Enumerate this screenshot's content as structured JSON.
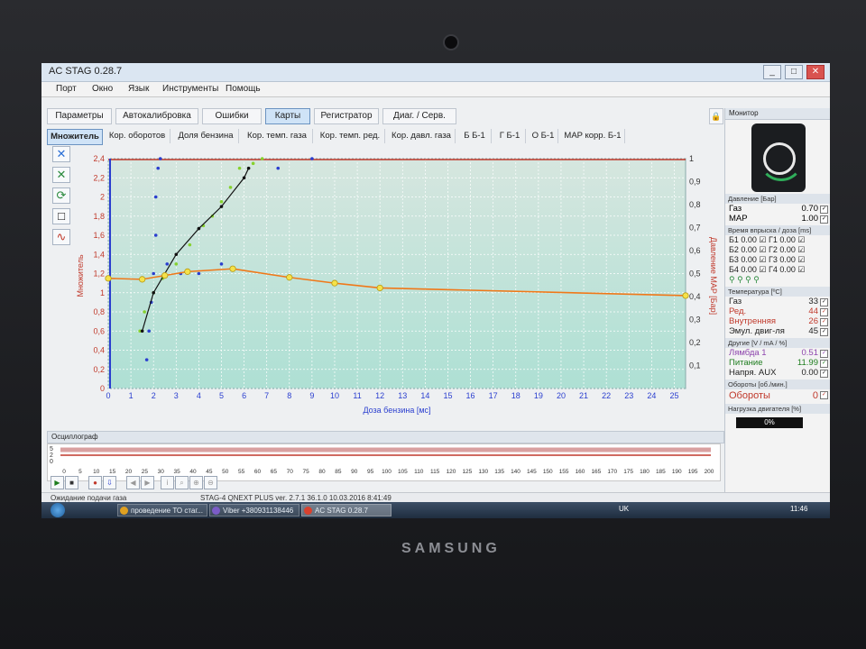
{
  "window": {
    "title": "AC STAG 0.28.7",
    "controls": [
      "_",
      "□",
      "✕"
    ]
  },
  "menu": [
    "Порт",
    "Окно",
    "Язык",
    "Инструменты",
    "Помощь"
  ],
  "tabs_main": [
    {
      "label": "Параметры",
      "active": false
    },
    {
      "label": "Автокалибровка",
      "active": false
    },
    {
      "label": "Ошибки",
      "active": false
    },
    {
      "label": "Карты",
      "active": true
    },
    {
      "label": "Регистратор",
      "active": false
    },
    {
      "label": "Диаг. / Серв.",
      "active": false
    }
  ],
  "tabs_maps": [
    {
      "label": "Множитель",
      "active": true
    },
    {
      "label": "Кор. оборотов",
      "active": false
    },
    {
      "label": "Доля бензина",
      "active": false
    },
    {
      "label": "Кор. темп. газа",
      "active": false
    },
    {
      "label": "Кор. темп. ред.",
      "active": false
    },
    {
      "label": "Кор. давл. газа",
      "active": false
    },
    {
      "label": "Б Б-1",
      "active": false
    },
    {
      "label": "Г Б-1",
      "active": false
    },
    {
      "label": "О Б-1",
      "active": false
    },
    {
      "label": "MAP корр. Б-1",
      "active": false
    }
  ],
  "chart_data": {
    "type": "line",
    "xlabel": "Доза бензина [мс]",
    "ylabel": "Множитель",
    "y2label": "Давление MAP [Бар]",
    "xlim": [
      0,
      25.5
    ],
    "ylim": [
      0,
      2.4
    ],
    "y2lim": [
      0,
      1
    ],
    "x_ticks": [
      "0",
      "1",
      "2",
      "3",
      "4",
      "5",
      "6",
      "7",
      "8",
      "9",
      "10",
      "11",
      "12",
      "13",
      "14",
      "15",
      "16",
      "17",
      "18",
      "19",
      "20",
      "21",
      "22",
      "23",
      "24",
      "25"
    ],
    "y_ticks": [
      "0",
      "0,2",
      "0,4",
      "0,6",
      "0,8",
      "1",
      "1,2",
      "1,4",
      "1,6",
      "1,8",
      "2",
      "2,2",
      "2,4"
    ],
    "y2_ticks": [
      "0,1",
      "0,2",
      "0,3",
      "0,4",
      "0,5",
      "0,6",
      "0,7",
      "0,8",
      "0,9",
      "1"
    ],
    "grid": true,
    "series": [
      {
        "name": "multiplier",
        "color": "#f07818",
        "points": [
          [
            0,
            1.15
          ],
          [
            1.5,
            1.14
          ],
          [
            2.5,
            1.18
          ],
          [
            3.5,
            1.22
          ],
          [
            5.5,
            1.25
          ],
          [
            8,
            1.16
          ],
          [
            10,
            1.1
          ],
          [
            12,
            1.05
          ],
          [
            25.5,
            0.97
          ]
        ]
      },
      {
        "name": "trend",
        "color": "#111111",
        "points": [
          [
            1.5,
            0.6
          ],
          [
            2,
            1.0
          ],
          [
            3,
            1.4
          ],
          [
            4,
            1.67
          ],
          [
            5,
            1.9
          ],
          [
            6,
            2.2
          ],
          [
            6.2,
            2.3
          ]
        ]
      },
      {
        "name": "petrol",
        "color": "#2a3ecf",
        "points": [
          [
            1.7,
            0.3
          ],
          [
            1.8,
            0.6
          ],
          [
            1.9,
            0.9
          ],
          [
            2.0,
            1.2
          ],
          [
            2.1,
            1.6
          ],
          [
            2.1,
            2.0
          ],
          [
            2.2,
            2.3
          ],
          [
            2.3,
            2.4
          ],
          [
            2.6,
            1.3
          ],
          [
            3.2,
            1.2
          ],
          [
            4.0,
            1.2
          ],
          [
            5.0,
            1.3
          ],
          [
            7.5,
            2.3
          ],
          [
            9.0,
            2.4
          ]
        ]
      },
      {
        "name": "gas",
        "color": "#86d12e",
        "points": [
          [
            1.4,
            0.6
          ],
          [
            1.6,
            0.8
          ],
          [
            2.0,
            1.0
          ],
          [
            2.4,
            1.15
          ],
          [
            3.0,
            1.3
          ],
          [
            3.6,
            1.5
          ],
          [
            4.2,
            1.7
          ],
          [
            4.6,
            1.8
          ],
          [
            5.0,
            1.95
          ],
          [
            5.4,
            2.1
          ],
          [
            5.8,
            2.3
          ],
          [
            6.4,
            2.35
          ],
          [
            6.8,
            2.4
          ]
        ]
      }
    ],
    "map_pressure_marker": 0.42
  },
  "monitor": {
    "title": "Монитор",
    "pressure": {
      "title": "Давление [Бар]",
      "rows": [
        {
          "label": "Газ",
          "value": "0.70"
        },
        {
          "label": "MAP",
          "value": "1.00"
        }
      ]
    },
    "injection": {
      "title": "Время впрыска / доза [ms]",
      "rows": [
        {
          "b": "Б1",
          "bv": "0.00",
          "g": "Г1",
          "gv": "0.00"
        },
        {
          "b": "Б2",
          "bv": "0.00",
          "g": "Г2",
          "gv": "0.00"
        },
        {
          "b": "Б3",
          "bv": "0.00",
          "g": "Г3",
          "gv": "0.00"
        },
        {
          "b": "Б4",
          "bv": "0.00",
          "g": "Г4",
          "gv": "0.00"
        }
      ]
    },
    "temperature": {
      "title": "Температура [ºC]",
      "rows": [
        {
          "label": "Газ",
          "value": "33",
          "color": "#222222"
        },
        {
          "label": "Ред.",
          "value": "44",
          "color": "#c0392b"
        },
        {
          "label": "Внутренняя",
          "value": "26",
          "color": "#c0392b"
        },
        {
          "label": "Эмул. двиг-ля",
          "value": "45",
          "color": "#222222"
        }
      ]
    },
    "other": {
      "title": "Другие [V / mA / %]",
      "rows": [
        {
          "label": "Лямбда 1",
          "value": "0.51",
          "color": "#8e44ad"
        },
        {
          "label": "Питание",
          "value": "11.99",
          "color": "#1e7d1e"
        },
        {
          "label": "Напря. AUX",
          "value": "0.00",
          "color": "#222222"
        }
      ]
    },
    "rpm": {
      "title": "Обороты [об./мин.]",
      "label": "Обороты",
      "value": "0"
    },
    "load": {
      "title": "Нагрузка двигателя [%]",
      "value": "0%"
    }
  },
  "oscillograph": {
    "title": "Осциллограф",
    "y_ticks": [
      "5",
      "2",
      "0"
    ],
    "x_ticks": [
      "0",
      "5",
      "10",
      "15",
      "20",
      "25",
      "30",
      "35",
      "40",
      "45",
      "50",
      "55",
      "60",
      "65",
      "70",
      "75",
      "80",
      "85",
      "90",
      "95",
      "100",
      "105",
      "110",
      "115",
      "120",
      "125",
      "130",
      "135",
      "140",
      "145",
      "150",
      "155",
      "160",
      "165",
      "170",
      "175",
      "180",
      "185",
      "190",
      "195",
      "200"
    ]
  },
  "status": {
    "left": "Ожидание подачи газа",
    "middle": "STAG-4 QNEXT PLUS ver. 2.7.1 36.1.0 10.03.2016 8:41:49"
  },
  "taskbar": {
    "items": [
      {
        "label": "проведение ТО стаг...",
        "color": "#e0a020"
      },
      {
        "label": "Viber +380931138446",
        "color": "#7b5cc7"
      },
      {
        "label": "AC STAG 0.28.7",
        "color": "#d9412e"
      }
    ],
    "lang": "UK",
    "clock": "11:46"
  },
  "device": {
    "brand": "SAMSUNG"
  }
}
